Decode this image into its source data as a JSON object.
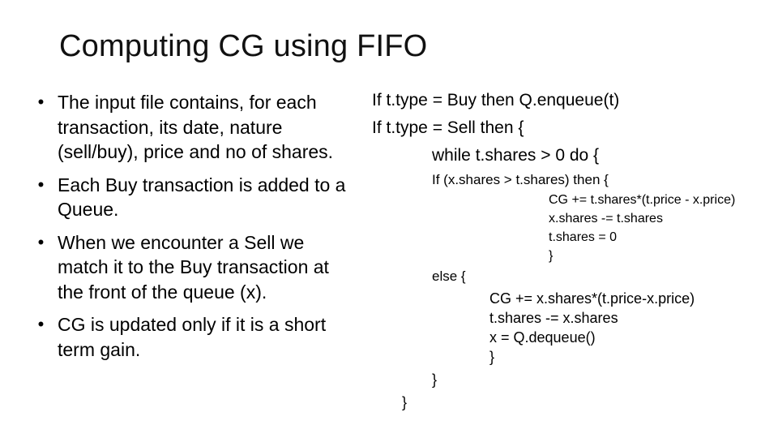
{
  "slide": {
    "title": "Computing CG using FIFO",
    "bullets": [
      "The input file contains, for each transaction, its date, nature (sell/buy), price and no of shares.",
      "Each Buy transaction is added to a Queue.",
      "When we encounter a Sell we match it to the Buy transaction at the front of the queue (x).",
      "CG is updated only if it is a short term gain."
    ],
    "bullet_glyph": "•",
    "code": {
      "line1": "If t.type = Buy then Q.enqueue(t)",
      "line2": "If t.type = Sell then {",
      "line3": "while t.shares > 0 do {",
      "line4": "If (x.shares > t.shares) then {",
      "line5": "CG += t.shares*(t.price - x.price)",
      "line6": "x.shares -= t.shares",
      "line7": "t.shares = 0",
      "line8": "}",
      "line9": "else {",
      "line10": "CG += x.shares*(t.price-x.price)",
      "line11": "t.shares -= x.shares",
      "line12": "x = Q.dequeue()",
      "line13": "}",
      "line14": "}",
      "line15": "}"
    }
  }
}
